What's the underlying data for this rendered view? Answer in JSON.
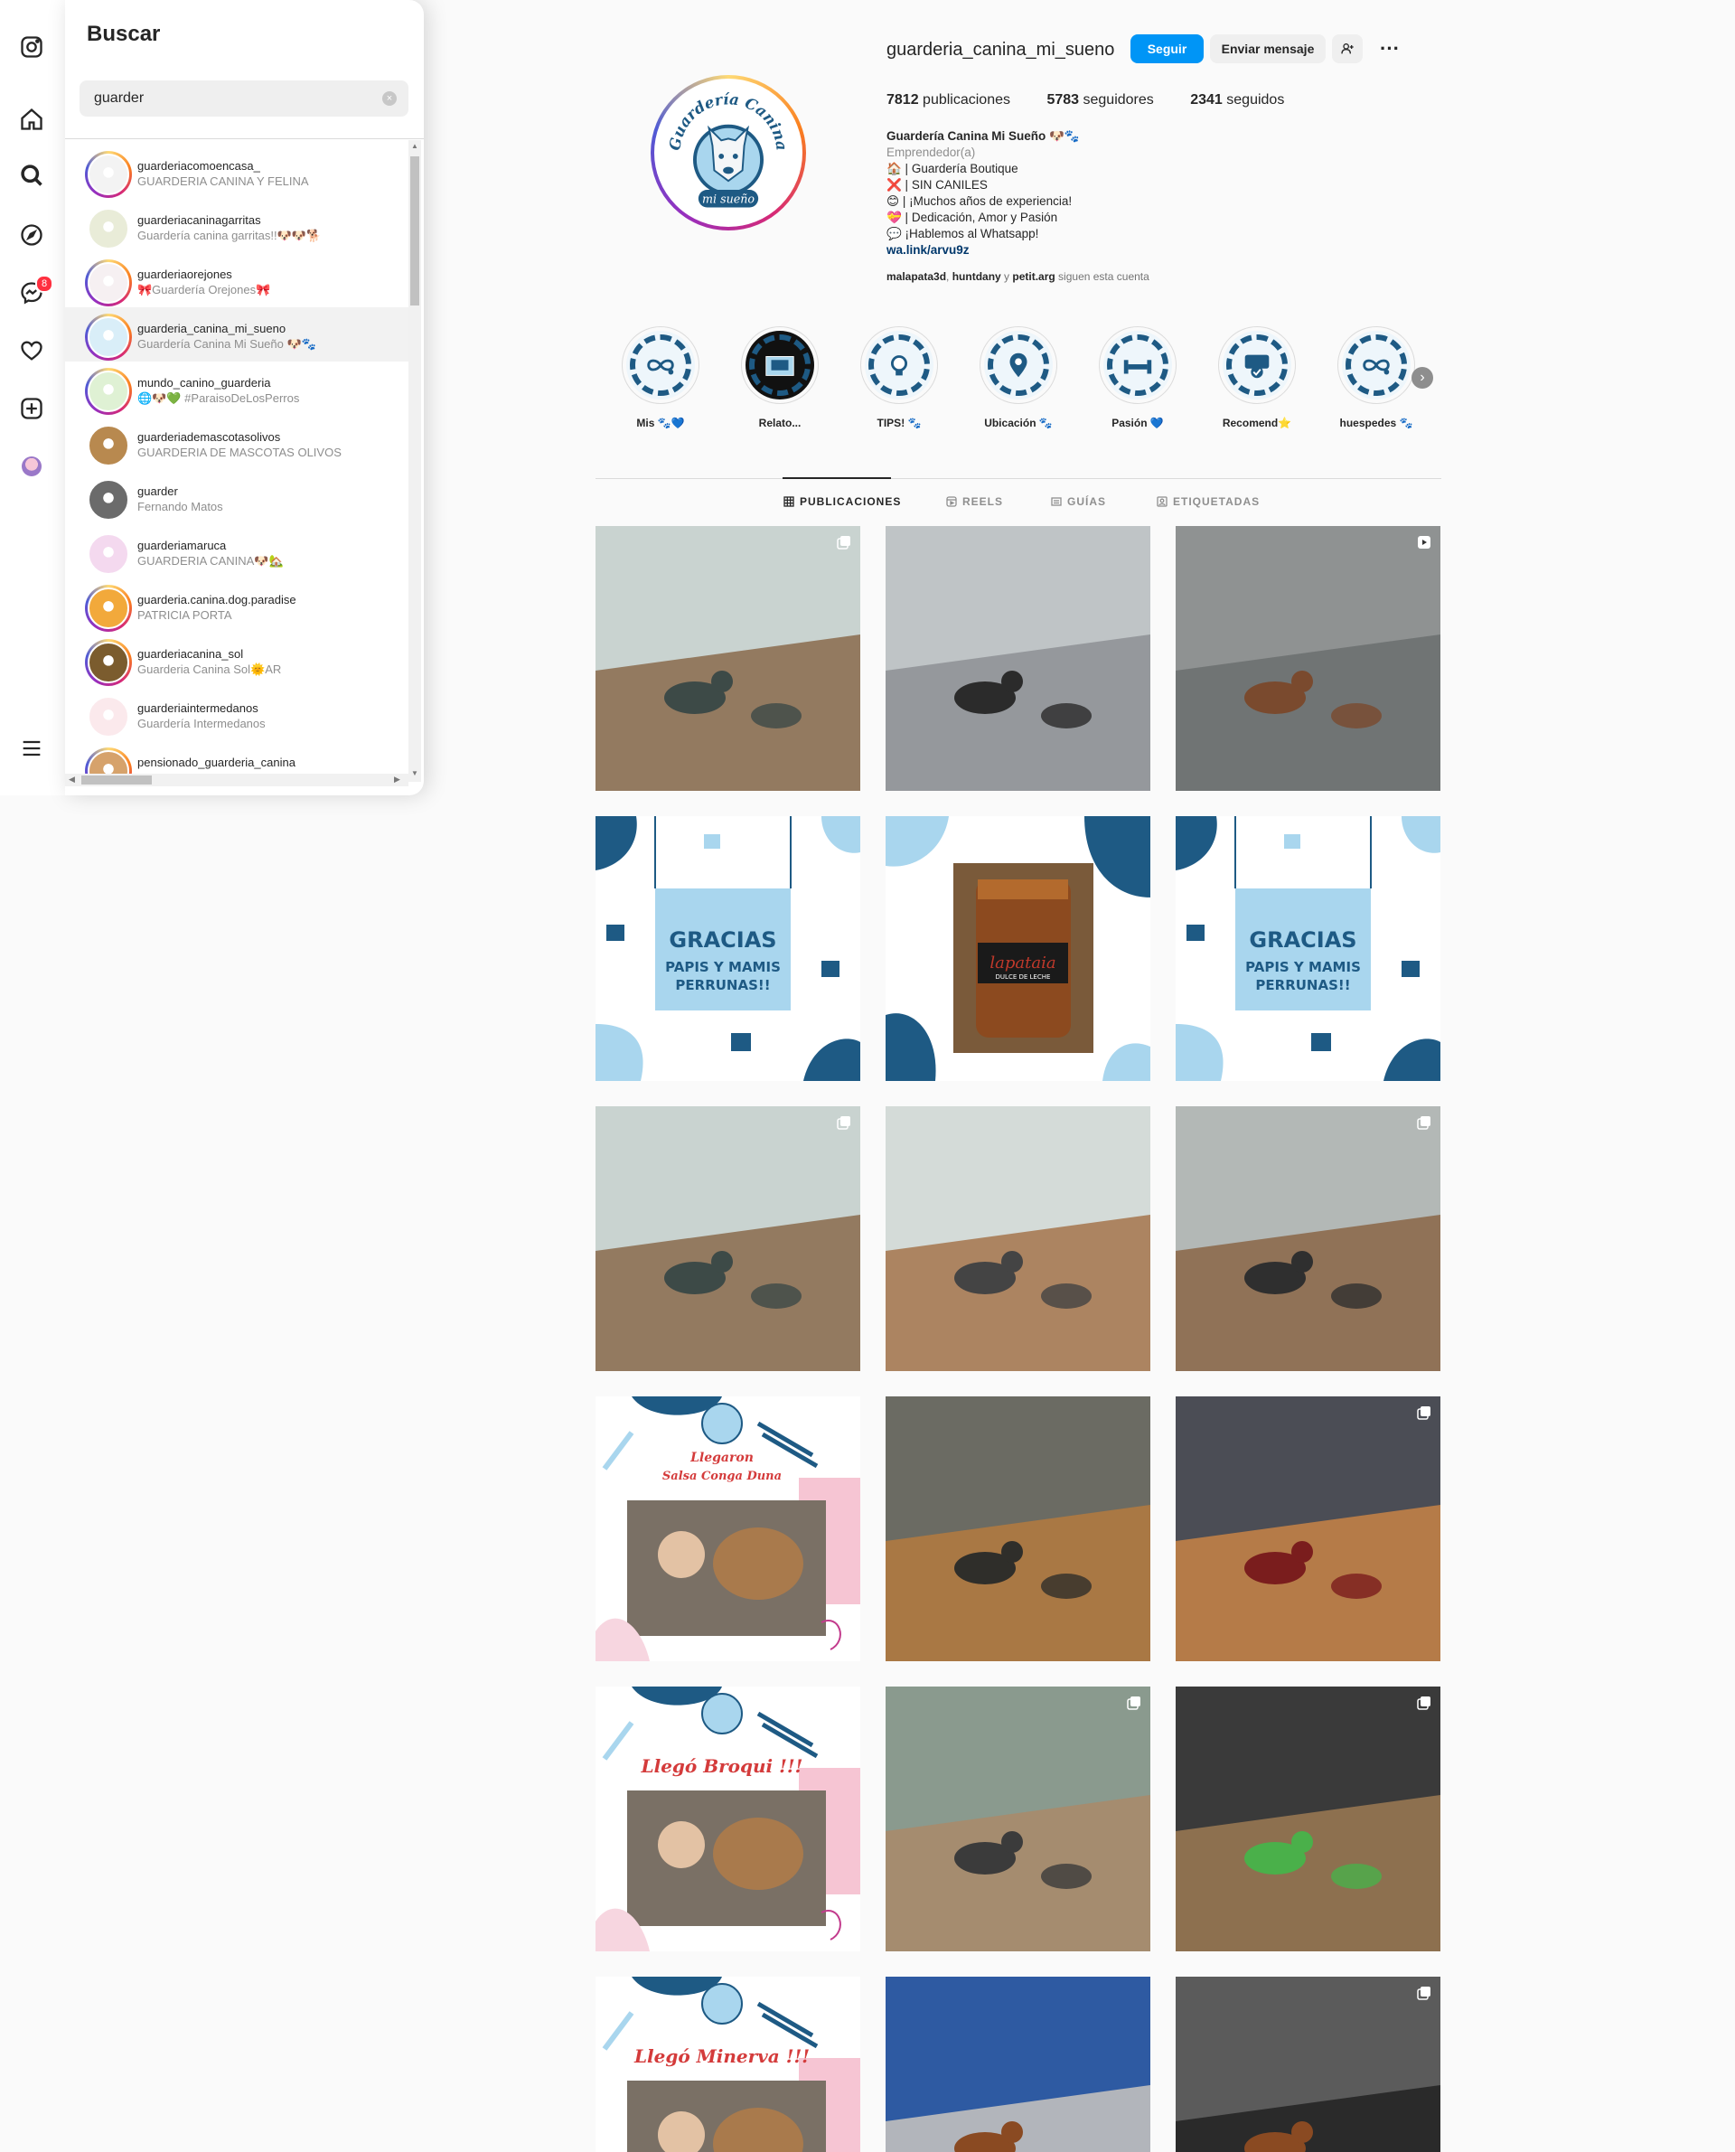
{
  "sidebar": {
    "messenger_badge": "8"
  },
  "search": {
    "title": "Buscar",
    "query": "guarder",
    "clear_symbol": "×",
    "results": [
      {
        "username": "guarderiacomoencasa_",
        "name": "GUARDERIA CANINA Y FELINA",
        "story": true,
        "color": "#f3f3f3"
      },
      {
        "username": "guarderiacaninagarritas",
        "name": "Guardería canina garritas!!🐶🐶🐕",
        "story": false,
        "color": "#e9ecd8"
      },
      {
        "username": "guarderiaorejones",
        "name": "🎀Guardería Orejones🎀",
        "story": true,
        "color": "#f6f0f2"
      },
      {
        "username": "guarderia_canina_mi_sueno",
        "name": "Guardería Canina Mi Sueño 🐶🐾",
        "story": true,
        "color": "#d9eef8",
        "active": true
      },
      {
        "username": "mundo_canino_guarderia",
        "name": "🌐🐶💚 #ParaisoDeLosPerros",
        "story": true,
        "color": "#dff1d4"
      },
      {
        "username": "guarderiademascotasolivos",
        "name": "GUARDERIA DE MASCOTAS OLIVOS",
        "story": false,
        "color": "#b8894f"
      },
      {
        "username": "guarder",
        "name": "Fernando Matos",
        "story": false,
        "color": "#6b6b6b"
      },
      {
        "username": "guarderiamaruca",
        "name": "GUARDERIA CANINA🐶🏡",
        "story": false,
        "color": "#f4d9ef"
      },
      {
        "username": "guarderia.canina.dog.paradise",
        "name": "PATRICIA PORTA",
        "story": true,
        "color": "#f2a93b"
      },
      {
        "username": "guarderiacanina_sol",
        "name": "Guarderia Canina Sol🌞AR",
        "story": true,
        "color": "#7b5c2e"
      },
      {
        "username": "guarderiaintermedanos",
        "name": "Guardería Intermedanos",
        "story": false,
        "color": "#fbe9ec"
      },
      {
        "username": "pensionado_guarderia_canina",
        "name": "",
        "story": true,
        "color": "#d6a26b"
      }
    ]
  },
  "profile": {
    "username": "guarderia_canina_mi_sueno",
    "follow_label": "Seguir",
    "message_label": "Enviar mensaje",
    "more_label": "···",
    "posts_count": "7812",
    "posts_label": "publicaciones",
    "followers_count": "5783",
    "followers_label": "seguidores",
    "following_count": "2341",
    "following_label": "seguidos",
    "bio_name": "Guardería Canina Mi Sueño 🐶🐾",
    "bio_category": "Emprendedor(a)",
    "bio_lines": [
      "🏠 | Guardería Boutique",
      "❌ | SIN CANILES",
      "😊 | ¡Muchos años de experiencia!",
      "💝 | Dedicación, Amor y Pasión",
      "💬 ¡Hablemos al Whatsapp!"
    ],
    "bio_link": "wa.link/arvu9z",
    "followed_by_1": "malapata3d",
    "followed_by_sep1": ", ",
    "followed_by_2": "huntdany",
    "followed_by_y": " y ",
    "followed_by_3": "petit.arg",
    "followed_by_suffix": " siguen esta cuenta",
    "logo_text_top": "Guardería Canina",
    "logo_text_bottom": "mi sueño"
  },
  "highlights": [
    {
      "label": "Mis 🐾💙",
      "icon": "infinity-paw-icon"
    },
    {
      "label": "Relato...",
      "icon": "histories-book-icon"
    },
    {
      "label": "TIPS! 🐾",
      "icon": "lightbulb-icon"
    },
    {
      "label": "Ubicación 🐾",
      "icon": "location-pin-icon"
    },
    {
      "label": "Pasión 💙",
      "icon": "dumbbell-icon"
    },
    {
      "label": "Recomend⭐",
      "icon": "rating-icon"
    },
    {
      "label": "huespedes 🐾",
      "icon": "infinity-paw-icon"
    }
  ],
  "tabs": [
    {
      "label": "PUBLICACIONES",
      "active": true
    },
    {
      "label": "REELS",
      "active": false
    },
    {
      "label": "GUÍAS",
      "active": false
    },
    {
      "label": "ETIQUETADAS",
      "active": false
    }
  ],
  "posts": [
    {
      "kind": "photo",
      "scene": "patio-dogs",
      "multi": true
    },
    {
      "kind": "photo",
      "scene": "dog-back",
      "multi": false
    },
    {
      "kind": "photo",
      "scene": "dogs-tiles",
      "multi": true,
      "reel": true
    },
    {
      "kind": "gracias",
      "line1": "GRACIAS",
      "line2": "PAPIS Y MAMIS",
      "line3": "PERRUNAS!!",
      "multi": false
    },
    {
      "kind": "jar",
      "label": "lapataia",
      "sublabel": "DULCE DE LECHE",
      "multi": false
    },
    {
      "kind": "gracias",
      "line1": "GRACIAS",
      "line2": "PAPIS Y MAMIS",
      "line3": "PERRUNAS!!",
      "multi": false
    },
    {
      "kind": "photo",
      "scene": "patio-dogs",
      "multi": true
    },
    {
      "kind": "photo",
      "scene": "patio-dogs2",
      "multi": false
    },
    {
      "kind": "photo",
      "scene": "patio-dogs3",
      "multi": true
    },
    {
      "kind": "arrival",
      "title": "Llegaron",
      "subtitle": "Salsa Conga Duna",
      "multi": false
    },
    {
      "kind": "photo",
      "scene": "brown-dogs",
      "multi": false
    },
    {
      "kind": "photo",
      "scene": "brown-dogs2",
      "multi": true
    },
    {
      "kind": "arrival",
      "title": "Llegó Broqui !!!",
      "subtitle": "",
      "multi": false
    },
    {
      "kind": "photo",
      "scene": "long-hair-dog",
      "multi": true
    },
    {
      "kind": "photo",
      "scene": "playing-dogs",
      "multi": true
    },
    {
      "kind": "arrival",
      "title": "Llegó Minerva !!!",
      "subtitle": "",
      "multi": false
    },
    {
      "kind": "photo",
      "scene": "dachshund",
      "multi": false
    },
    {
      "kind": "photo",
      "scene": "black-dogs",
      "multi": true
    }
  ],
  "colors": {
    "accent": "#0095f6",
    "brand_blue": "#1e5a84",
    "light_blue": "#a9d6ee",
    "badge": "#ff3040"
  }
}
